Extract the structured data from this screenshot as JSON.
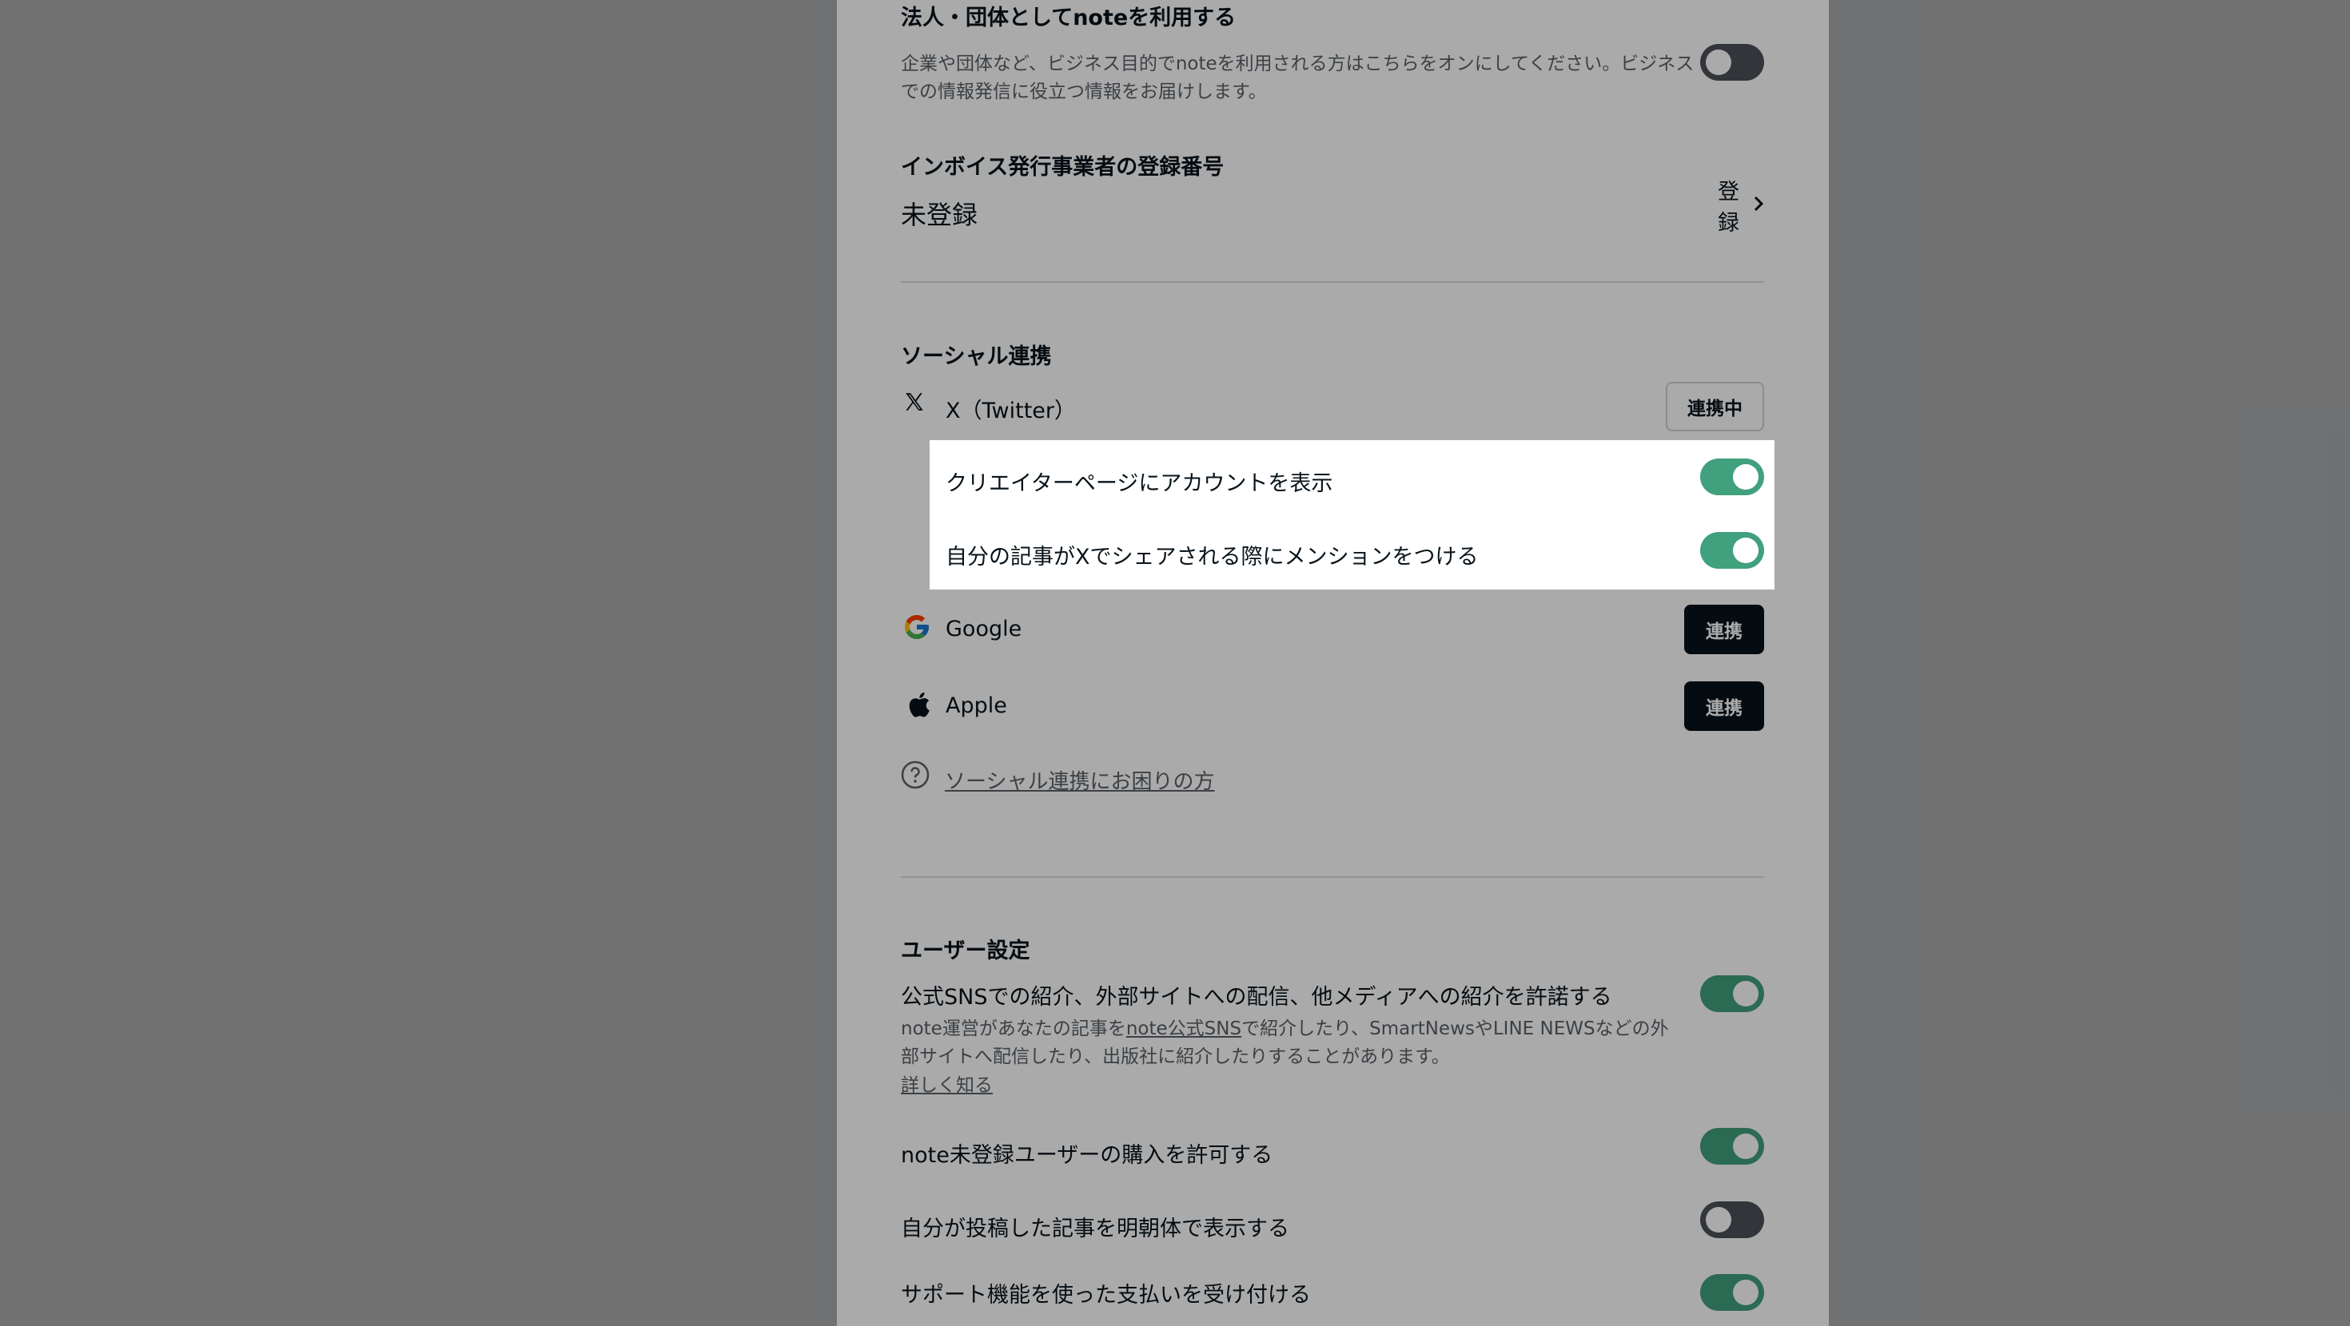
{
  "corporate": {
    "title": "法人・団体としてnoteを利用する",
    "desc_line1": "企業や団体など、ビジネス目的でnoteを利用される方はこちらをオンにしてください。ビジネス",
    "desc_line2": "での情報発信に役立つ情報をお届けします。",
    "enabled": false
  },
  "invoice": {
    "title": "インボイス発行事業者の登録番号",
    "status": "未登録",
    "register_label": "登録"
  },
  "social": {
    "heading": "ソーシャル連携",
    "twitter_label": "X（Twitter）",
    "twitter_button": "連携中",
    "show_account_label": "クリエイターページにアカウントを表示",
    "show_account_enabled": true,
    "mention_label": "自分の記事がXでシェアされる際にメンションをつける",
    "mention_enabled": true,
    "google_label": "Google",
    "google_button": "連携",
    "apple_label": "Apple",
    "apple_button": "連携",
    "help_link": "ソーシャル連携にお困りの方"
  },
  "user_settings": {
    "heading": "ユーザー設定",
    "sns_title": "公式SNSでの紹介、外部サイトへの配信、他メディアへの紹介を許諾する",
    "sns_desc_a": "note運営があなたの記事を",
    "sns_desc_link": "note公式SNS",
    "sns_desc_b": "で紹介したり、SmartNewsやLINE NEWSなどの外",
    "sns_desc_line2": "部サイトへ配信したり、出版社に紹介したりすることがあります。",
    "sns_more": "詳しく知る",
    "sns_enabled": true,
    "guest_purchase": "note未登録ユーザーの購入を許可する",
    "guest_purchase_enabled": true,
    "mincho": "自分が投稿した記事を明朝体で表示する",
    "mincho_enabled": false,
    "support": "サポート機能を使った支払いを受け付ける",
    "support_enabled": true
  }
}
